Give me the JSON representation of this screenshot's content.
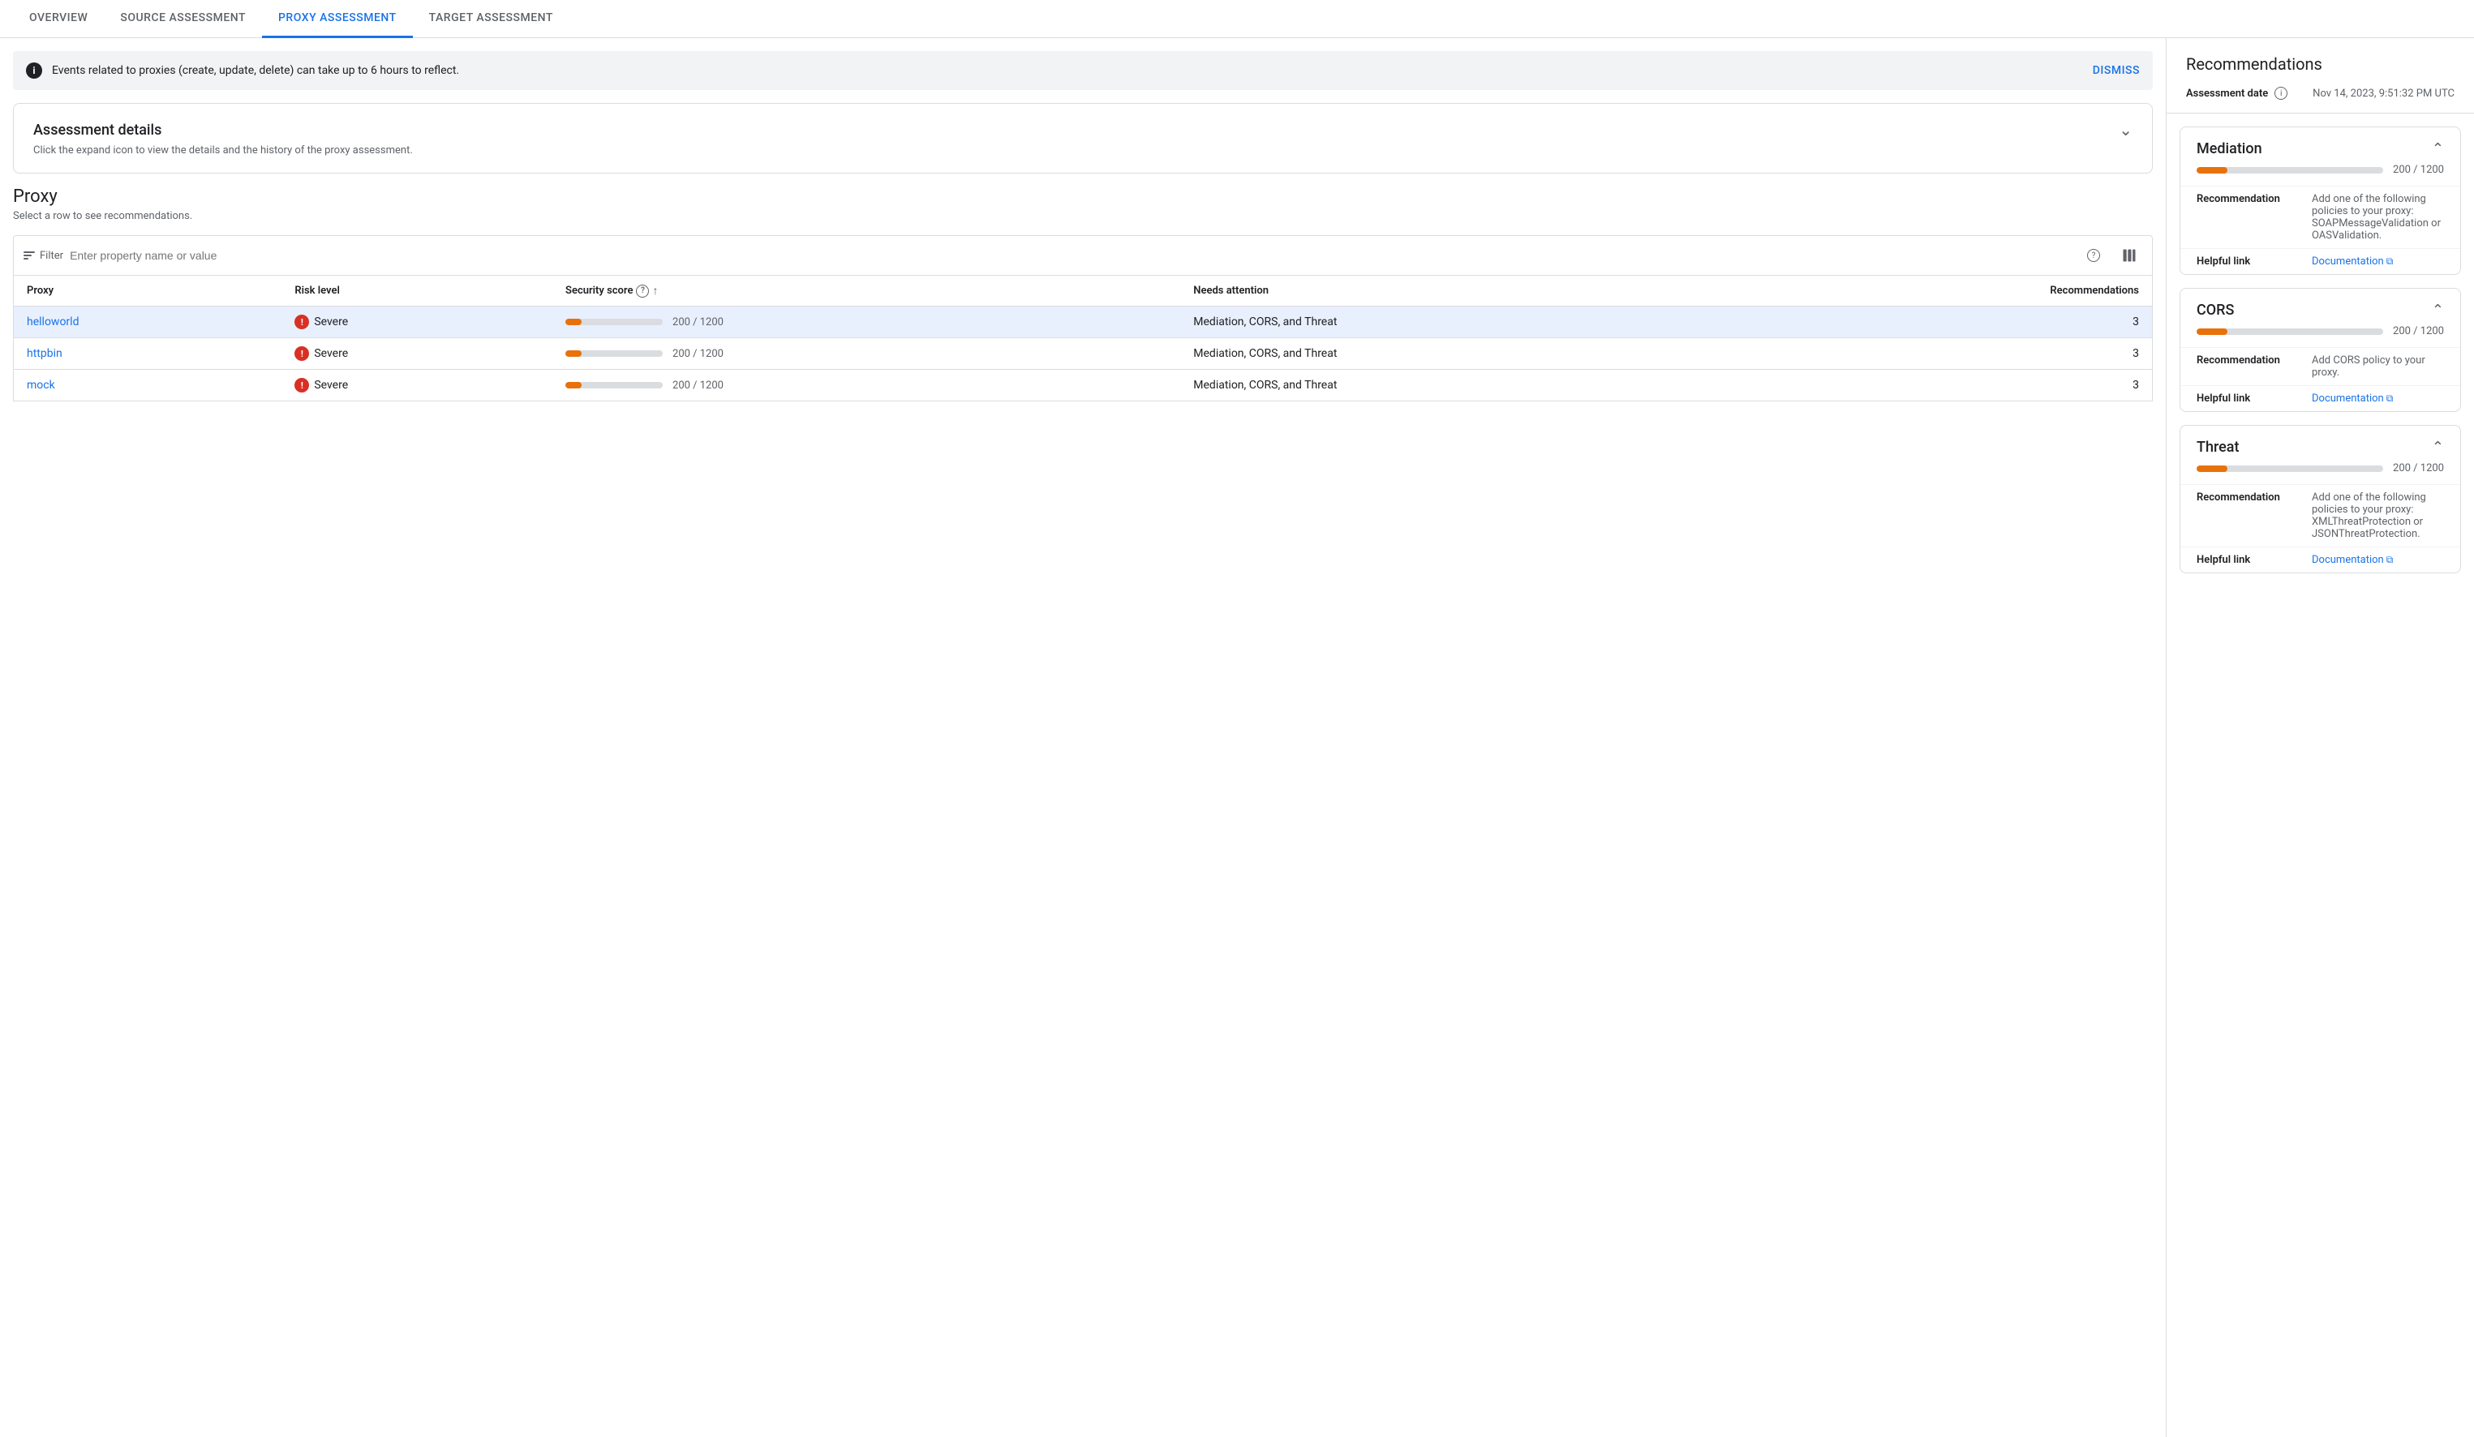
{
  "nav": {
    "tabs": [
      {
        "label": "OVERVIEW",
        "active": false
      },
      {
        "label": "SOURCE ASSESSMENT",
        "active": false
      },
      {
        "label": "PROXY ASSESSMENT",
        "active": true
      },
      {
        "label": "TARGET ASSESSMENT",
        "active": false
      }
    ]
  },
  "infoBanner": {
    "text": "Events related to proxies (create, update, delete) can take up to 6 hours to reflect.",
    "dismissLabel": "DISMISS"
  },
  "assessmentDetails": {
    "title": "Assessment details",
    "subtitle": "Click the expand icon to view the details and the history of the proxy assessment."
  },
  "proxy": {
    "title": "Proxy",
    "subtitle": "Select a row to see recommendations.",
    "filterPlaceholder": "Enter property name or value",
    "columns": {
      "proxy": "Proxy",
      "riskLevel": "Risk level",
      "securityScore": "Security score",
      "needsAttention": "Needs attention",
      "recommendations": "Recommendations"
    },
    "rows": [
      {
        "name": "helloworld",
        "risk": "Severe",
        "scoreValue": 200,
        "scoreMax": 1200,
        "needsAttention": "Mediation, CORS, and Threat",
        "recommendations": 3,
        "selected": true
      },
      {
        "name": "httpbin",
        "risk": "Severe",
        "scoreValue": 200,
        "scoreMax": 1200,
        "needsAttention": "Mediation, CORS, and Threat",
        "recommendations": 3,
        "selected": false
      },
      {
        "name": "mock",
        "risk": "Severe",
        "scoreValue": 200,
        "scoreMax": 1200,
        "needsAttention": "Mediation, CORS, and Threat",
        "recommendations": 3,
        "selected": false
      }
    ]
  },
  "rightPanel": {
    "title": "Recommendations",
    "assessmentDate": {
      "label": "Assessment date",
      "value": "Nov 14, 2023, 9:51:32 PM UTC"
    },
    "recommendations": [
      {
        "title": "Mediation",
        "scoreValue": 200,
        "scoreMax": 1200,
        "scoreText": "200 / 1200",
        "recommendation": "Add one of the following policies to your proxy: SOAPMessageValidation or OASValidation.",
        "helpfulLink": "Documentation",
        "expanded": true
      },
      {
        "title": "CORS",
        "scoreValue": 200,
        "scoreMax": 1200,
        "scoreText": "200 / 1200",
        "recommendation": "Add CORS policy to your proxy.",
        "helpfulLink": "Documentation",
        "expanded": true
      },
      {
        "title": "Threat",
        "scoreValue": 200,
        "scoreMax": 1200,
        "scoreText": "200 / 1200",
        "recommendation": "Add one of the following policies to your proxy: XMLThreatProtection or JSONThreatProtection.",
        "helpfulLink": "Documentation",
        "expanded": true
      }
    ]
  }
}
